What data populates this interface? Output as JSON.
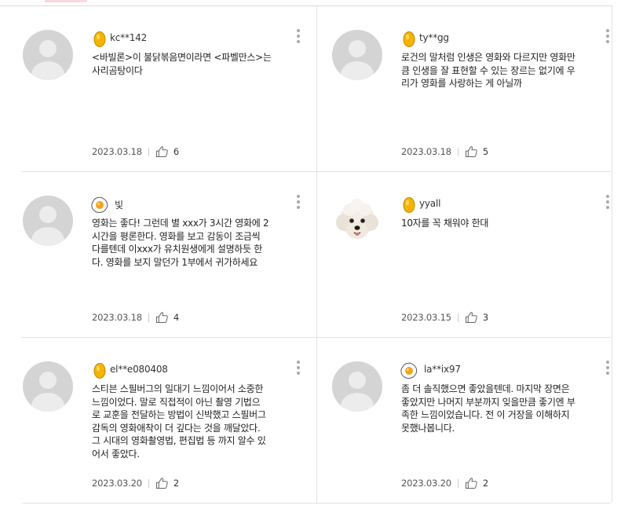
{
  "reviews": [
    {
      "nickname": "kc**142",
      "badge": "gold",
      "text": "<바빌론>이 불닭볶음면이라면 <파벨만스>는\n사리곰탕이다",
      "date": "2023.03.18",
      "likes": "6",
      "avatar": "default"
    },
    {
      "nickname": "ty**gg",
      "badge": "gold",
      "text": "로건의 말처럼 인생은 영화와 다르지만 영화만\n큼 인생을 잘 표현할 수 있는 장르는 없기에 우\n리가 영화를 사랑하는 게 아닐까",
      "date": "2023.03.18",
      "likes": "5",
      "avatar": "default"
    },
    {
      "nickname": "빛",
      "badge": "egg",
      "text": "영화는 좋다! 그런데 별 xxx가 3시간 영화에 2\n시간을 평론한다. 영화를 보고 감동이 조금씩\n다를텐데 이xxx가 유치원생에게 설명하듯 한\n다. 영화를 보지 말던가 1부에서 귀가하세요",
      "date": "2023.03.18",
      "likes": "4",
      "avatar": "default"
    },
    {
      "nickname": "yyall",
      "badge": "gold",
      "text": "10자를 꼭 채워야 한대",
      "date": "2023.03.15",
      "likes": "3",
      "avatar": "dog"
    },
    {
      "nickname": "el**e080408",
      "badge": "gold",
      "text": "스티븐 스필버그의 일대기 느낌이어서 소중한\n느낌이었다. 말로 직접적이 아닌 촬영 기법으\n로 교훈을 전달하는 방법이 신박했고 스필버그\n감독의 영화애착이 더 깊다는 것을 깨달았다.\n그 시대의 영화촬영법, 편집법 등 까지 알수 있\n어서 좋았다.",
      "date": "2023.03.20",
      "likes": "2",
      "avatar": "default"
    },
    {
      "nickname": "la**ix97",
      "badge": "egg",
      "text": "좀 더 솔직했으면 좋았을텐데. 마지막 장면은\n좋았지만 나머지 부분까지 잊을만큼 좋기엔 부\n족한 느낌이었습니다. 전 이 거장을 이해하지\n못했나봅니다.",
      "date": "2023.03.20",
      "likes": "2",
      "avatar": "default"
    }
  ],
  "colors": {
    "gold": "#f5b400",
    "accent_pink": "#f7d9df"
  }
}
